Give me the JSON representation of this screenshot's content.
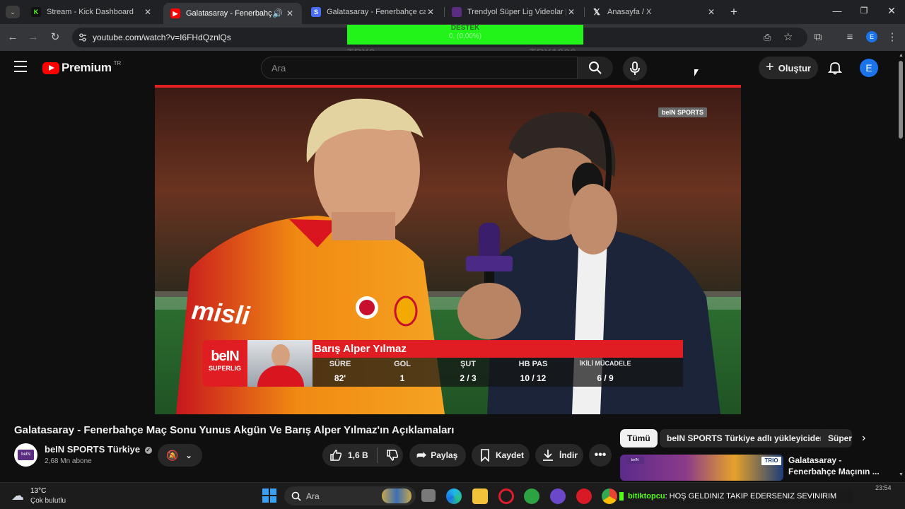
{
  "browser": {
    "tabs": [
      {
        "title": "Stream - Kick Dashboard",
        "favicon": "kick-icon",
        "color": "#53fc18"
      },
      {
        "title": "Galatasaray - Fenerbahçe M",
        "favicon": "youtube-icon",
        "color": "#ff0000",
        "audio": true
      },
      {
        "title": "Galatasaray - Fenerbahçe canlı",
        "favicon": "bookmark-icon",
        "color": "#4a6cf7"
      },
      {
        "title": "Trendyol Süper Lig Videolar | be",
        "favicon": "bein-icon",
        "color": "#5a2d82"
      },
      {
        "title": "Anasayfa / X",
        "favicon": "x-icon",
        "color": "#000000"
      }
    ],
    "url": "youtube.com/watch?v=I6FHdQznlQs"
  },
  "overlay": {
    "donation_title": "DESTEK",
    "donation_progress_text": "0, (0,00%)",
    "progress": 0,
    "min_label": "TRY0",
    "max_label": "TRY1000"
  },
  "youtube": {
    "logo_text": "Premium",
    "logo_region": "TR",
    "search_placeholder": "Ara",
    "create_label": "Oluştur",
    "avatar_letter": "E"
  },
  "video": {
    "broadcaster_badge": "beIN SPORTS",
    "jersey_sponsor": "misli",
    "lower_third": {
      "player_name": "Barış Alper Yılmaz",
      "brand_top": "beIN",
      "brand_bottom": "SUPERLIG",
      "stats": [
        {
          "label": "SÜRE",
          "value": "82'"
        },
        {
          "label": "GOL",
          "value": "1"
        },
        {
          "label": "ŞUT",
          "value": "2 / 3"
        },
        {
          "label": "HB PAS",
          "value": "10 / 12"
        },
        {
          "label": "İKİLİ MÜCADELE",
          "value": "6 / 9"
        }
      ]
    },
    "title": "Galatasaray - Fenerbahçe Maç Sonu Yunus Akgün Ve Barış Alper Yılmaz'ın Açıklamaları",
    "channel": "beIN SPORTS Türkiye",
    "subscribers": "2,68 Mn abone",
    "likes": "1,6 B",
    "share_label": "Paylaş",
    "save_label": "Kaydet",
    "download_label": "İndir"
  },
  "sidebar": {
    "chips": [
      "Tümü",
      "beIN SPORTS Türkiye adlı yükleyiciden",
      "Süper"
    ],
    "recommended": {
      "title_line1": "Galatasaray -",
      "title_line2": "Fenerbahçe Maçının ..."
    }
  },
  "taskbar": {
    "weather_temp": "13°C",
    "weather_desc": "Çok bulutlu",
    "search_label": "Ara",
    "ticker_user": "bitiktopcu",
    "ticker_text": ": HOŞ GELDINIZ TAKIP EDERSENIZ SEVINIRIM",
    "clock": "23:54"
  }
}
